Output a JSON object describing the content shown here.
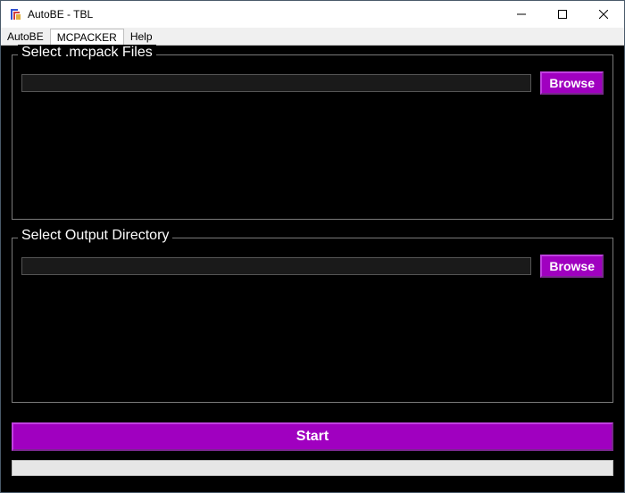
{
  "window": {
    "title": "AutoBE - TBL"
  },
  "menubar": {
    "items": [
      {
        "label": "AutoBE",
        "active": false
      },
      {
        "label": "MCPACKER",
        "active": true
      },
      {
        "label": "Help",
        "active": false
      }
    ]
  },
  "sections": {
    "input": {
      "legend": "Select .mcpack Files",
      "value": "",
      "browse_label": "Browse"
    },
    "output": {
      "legend": "Select Output Directory",
      "value": "",
      "browse_label": "Browse"
    }
  },
  "actions": {
    "start_label": "Start"
  },
  "progress": {
    "value": 0,
    "max": 100
  },
  "colors": {
    "accent": "#a000c0",
    "background": "#000000"
  }
}
